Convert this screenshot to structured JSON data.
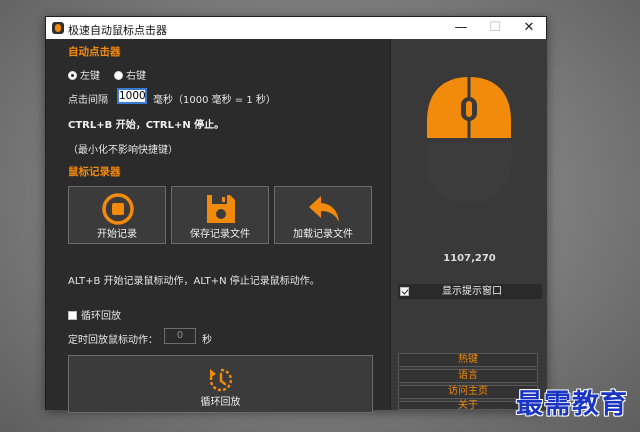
{
  "window": {
    "title": "极速自动鼠标点击器",
    "minimize_glyph": "—",
    "maximize_glyph": "☐",
    "close_glyph": "✕"
  },
  "auto_clicker": {
    "section_title": "自动点击器",
    "left_key_label": "左键",
    "right_key_label": "右键",
    "selected_key": "left",
    "interval_label": "点击间隔",
    "interval_value": "1000",
    "interval_unit_note": "毫秒（1000 毫秒 = 1 秒）",
    "hotkey_hint": "CTRL+B 开始，CTRL+N 停止。",
    "minimize_note": "（最小化不影响快捷键）"
  },
  "recorder": {
    "section_title": "鼠标记录器",
    "buttons": [
      {
        "label": "开始记录",
        "icon": "record-icon"
      },
      {
        "label": "保存记录文件",
        "icon": "save-icon"
      },
      {
        "label": "加载记录文件",
        "icon": "undo-arrow-icon"
      }
    ],
    "hotkey_hint": "ALT+B 开始记录鼠标动作，ALT+N 停止记录鼠标动作。",
    "loop_playback_label": "循环回放",
    "loop_playback_checked": false,
    "timed_playback_label": "定时回放鼠标动作：",
    "timed_playback_placeholder": "0",
    "timed_playback_unit": "秒",
    "loop_button_label": "循环回放",
    "loop_button_icon": "replay-icon"
  },
  "sidebar": {
    "coordinates": "1107,270",
    "show_tip_label": "显示提示窗口",
    "show_tip_checked": true,
    "links": [
      "热键",
      "语言",
      "访问主页",
      "关于"
    ]
  },
  "colors": {
    "accent": "#f28a0c",
    "window_bg": "#2b2b2b",
    "sidebar_bg": "#393939",
    "mouse_body": "#3c3c3c"
  },
  "watermark": "最需教育"
}
